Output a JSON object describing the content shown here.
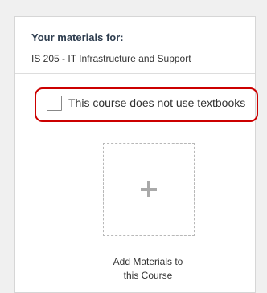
{
  "materials": {
    "heading": "Your materials for:",
    "course_name": "IS 205 - IT Infrastructure and Support"
  },
  "no_textbook_option": {
    "label": "This course does not use textbooks",
    "checked": false
  },
  "add_materials": {
    "icon": "plus-icon",
    "label_line1": "Add Materials to",
    "label_line2": "this Course"
  },
  "colors": {
    "highlight_border": "#cc0000",
    "heading_text": "#2e3d4f"
  }
}
